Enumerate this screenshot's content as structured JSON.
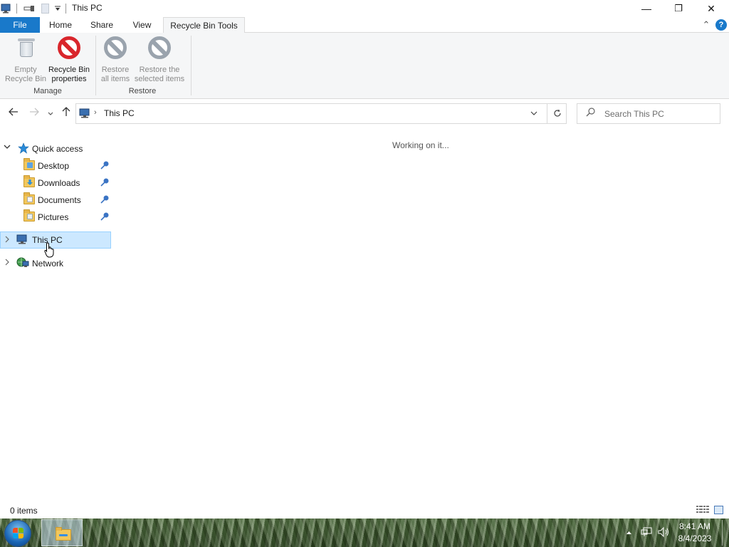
{
  "window": {
    "title": "This PC",
    "minimize_glyph": "—",
    "restore_glyph": "❐",
    "close_glyph": "✕"
  },
  "ribbon_tabs": {
    "file": "File",
    "home": "Home",
    "share": "Share",
    "view": "View",
    "tools": "Recycle Bin Tools"
  },
  "ribbon": {
    "empty_bin": {
      "line1": "Empty",
      "line2": "Recycle Bin"
    },
    "bin_properties": {
      "line1": "Recycle Bin",
      "line2": "properties"
    },
    "restore_all": {
      "line1": "Restore",
      "line2": "all items"
    },
    "restore_selected": {
      "line1": "Restore the",
      "line2": "selected items"
    },
    "group_manage": "Manage",
    "group_restore": "Restore",
    "collapse_glyph": "⌃",
    "help_glyph": "?"
  },
  "address_bar": {
    "path": "This PC",
    "separator": "›"
  },
  "search": {
    "placeholder": "Search This PC"
  },
  "nav_pane": {
    "quick_access": "Quick access",
    "pinned": [
      "Desktop",
      "Downloads",
      "Documents",
      "Pictures"
    ],
    "this_pc": "This PC",
    "network": "Network"
  },
  "content": {
    "status_message": "Working on it..."
  },
  "status_bar": {
    "item_count": "0 items"
  },
  "taskbar": {
    "time": "8:41 AM",
    "date": "8/4/2023"
  },
  "colors": {
    "file_tab": "#1979ca",
    "selection": "#cce8ff",
    "no_sign_red": "#d9262c",
    "no_sign_disabled": "#9aa3ad"
  }
}
